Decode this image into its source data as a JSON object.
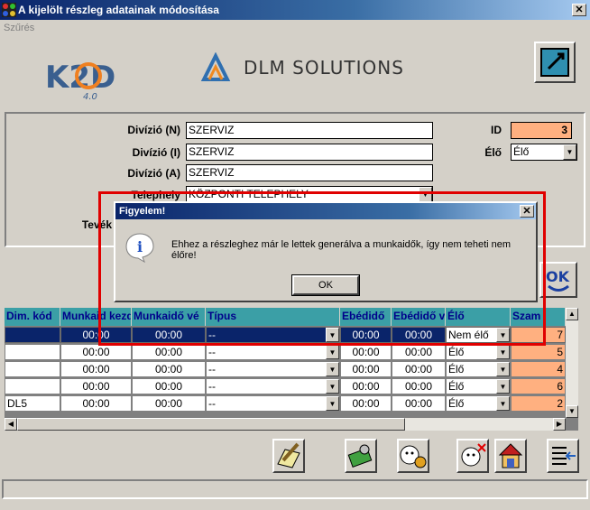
{
  "window": {
    "title": "A kijelölt részleg adatainak módosítása",
    "close_glyph": "✕"
  },
  "menu": {
    "szures": "Szűrés"
  },
  "logos": {
    "k2d_main": "K2D",
    "k2d_version": "4.0",
    "dlm_text": "DLM SOLUTIONS"
  },
  "form": {
    "divizio_n_label": "Divízió (N)",
    "divizio_n_value": "SZERVIZ",
    "divizio_i_label": "Divízió (I)",
    "divizio_i_value": "SZERVIZ",
    "divizio_a_label": "Divízió (A)",
    "divizio_a_value": "SZERVIZ",
    "telephely_label": "Telephely",
    "telephely_value": "KÖZPONTI TELEPHELY",
    "tevek_label": "Tevék",
    "id_label": "ID",
    "id_value": "3",
    "elo_label": "Élő",
    "elo_value": "Élő"
  },
  "ok_button": {
    "label": "OK"
  },
  "grid": {
    "headers": [
      "Dim. kód",
      "Munkaid kezd",
      "Munkaidő vé",
      "Típus",
      "Ebédidő",
      "Ebédidő v",
      "Élő",
      "Szam"
    ],
    "rows": [
      {
        "dim": "",
        "start": "00:00",
        "end": "00:00",
        "type": "--",
        "lunch_start": "00:00",
        "lunch_end": "00:00",
        "elo": "Nem élő",
        "szam": "7"
      },
      {
        "dim": "",
        "start": "00:00",
        "end": "00:00",
        "type": "--",
        "lunch_start": "00:00",
        "lunch_end": "00:00",
        "elo": "Élő",
        "szam": "5"
      },
      {
        "dim": "",
        "start": "00:00",
        "end": "00:00",
        "type": "--",
        "lunch_start": "00:00",
        "lunch_end": "00:00",
        "elo": "Élő",
        "szam": "4"
      },
      {
        "dim": "",
        "start": "00:00",
        "end": "00:00",
        "type": "--",
        "lunch_start": "00:00",
        "lunch_end": "00:00",
        "elo": "Élő",
        "szam": "6"
      },
      {
        "dim": "DL5",
        "start": "00:00",
        "end": "00:00",
        "type": "--",
        "lunch_start": "00:00",
        "lunch_end": "00:00",
        "elo": "Élő",
        "szam": "2"
      }
    ]
  },
  "dialog": {
    "title": "Figyelem!",
    "close_glyph": "✕",
    "message": "Ehhez a részleghez már le lettek generálva a munkaidők, így nem teheti nem élőre!",
    "ok_label": "OK",
    "info_glyph": "i"
  },
  "colors": {
    "title_blue": "#0a246a",
    "header_teal": "#3b9fa6",
    "id_orange": "#ffb080",
    "highlight_red": "#e00000"
  }
}
